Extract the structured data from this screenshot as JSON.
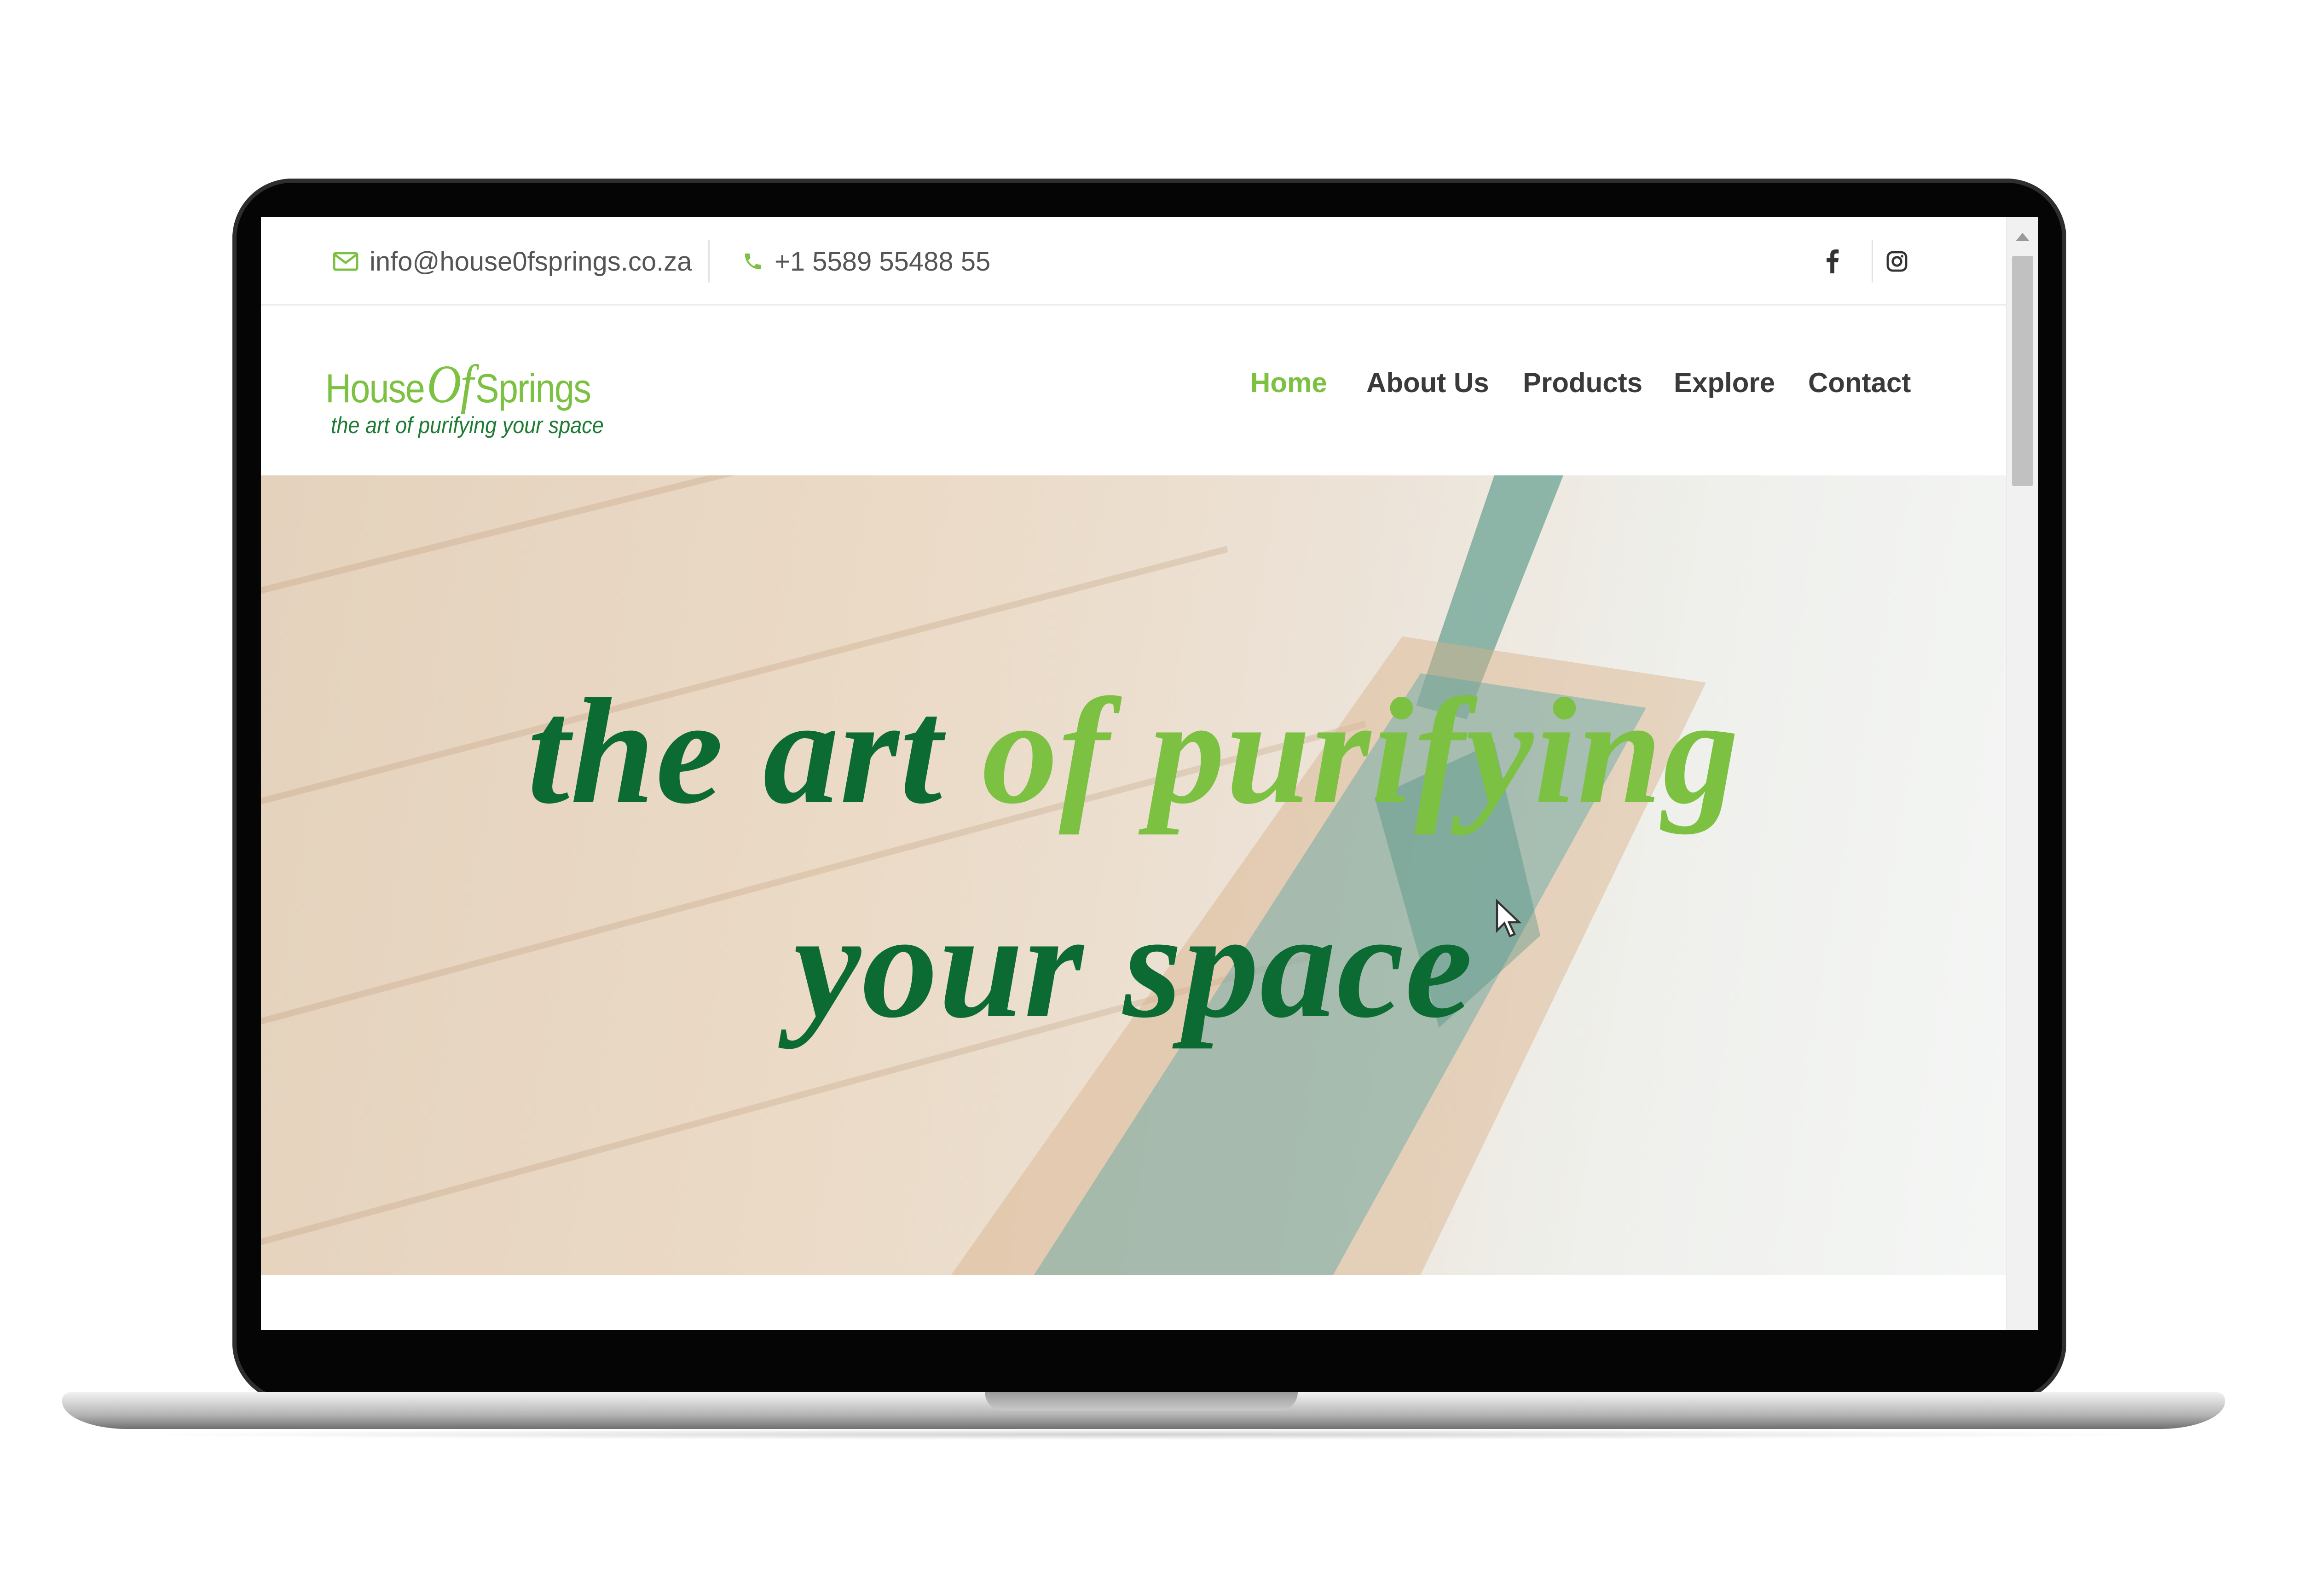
{
  "topbar": {
    "email": "info@house0fsprings.co.za",
    "phone": "+1 5589 55488 55",
    "icons": [
      "envelope-icon",
      "phone-icon",
      "facebook-icon",
      "instagram-icon"
    ]
  },
  "logo": {
    "name_part1": "House",
    "name_part2": "Of",
    "name_part3": "Springs",
    "tagline": "the art of purifying your space"
  },
  "nav": {
    "items": [
      {
        "label": "Home",
        "active": true
      },
      {
        "label": "About Us",
        "active": false
      },
      {
        "label": "Products",
        "active": false
      },
      {
        "label": "Explore",
        "active": false
      },
      {
        "label": "Contact",
        "active": false
      }
    ]
  },
  "hero": {
    "line1_dark": "the art",
    "line1_light": "of purifying",
    "line2": "your space"
  },
  "colors": {
    "brand_green_light": "#7cc142",
    "brand_green_dark": "#0c6b33",
    "nav_text": "#3a3a3a"
  }
}
